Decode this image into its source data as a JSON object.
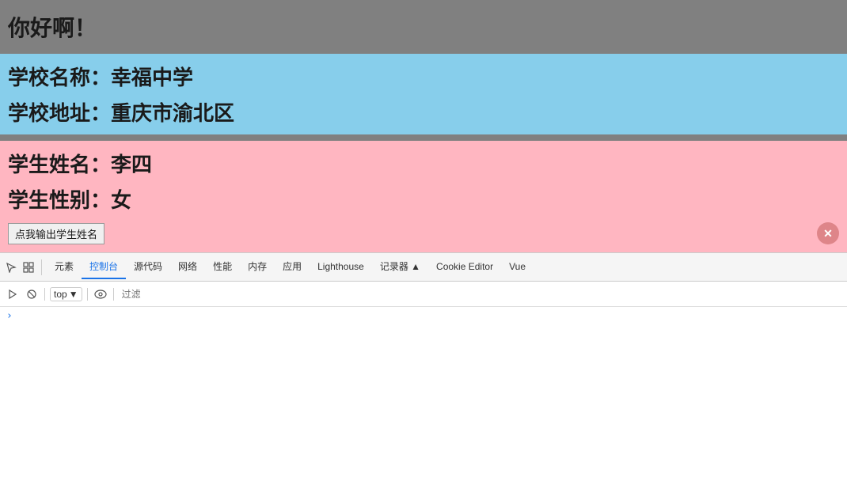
{
  "header": {
    "greeting": "你好啊！"
  },
  "school": {
    "name_label": "学校名称：幸福中学",
    "address_label": "学校地址：重庆市渝北区"
  },
  "student": {
    "name_label": "学生姓名：李四",
    "gender_label": "学生性别：女",
    "button_label": "点我输出学生姓名"
  },
  "devtools": {
    "tabs": [
      "元素",
      "控制台",
      "源代码",
      "网络",
      "性能",
      "内存",
      "应用",
      "Lighthouse",
      "记录器 ▲",
      "Cookie Editor",
      "Vue"
    ],
    "active_tab": "控制台",
    "top_dropdown": "top",
    "filter_placeholder": "过滤"
  }
}
